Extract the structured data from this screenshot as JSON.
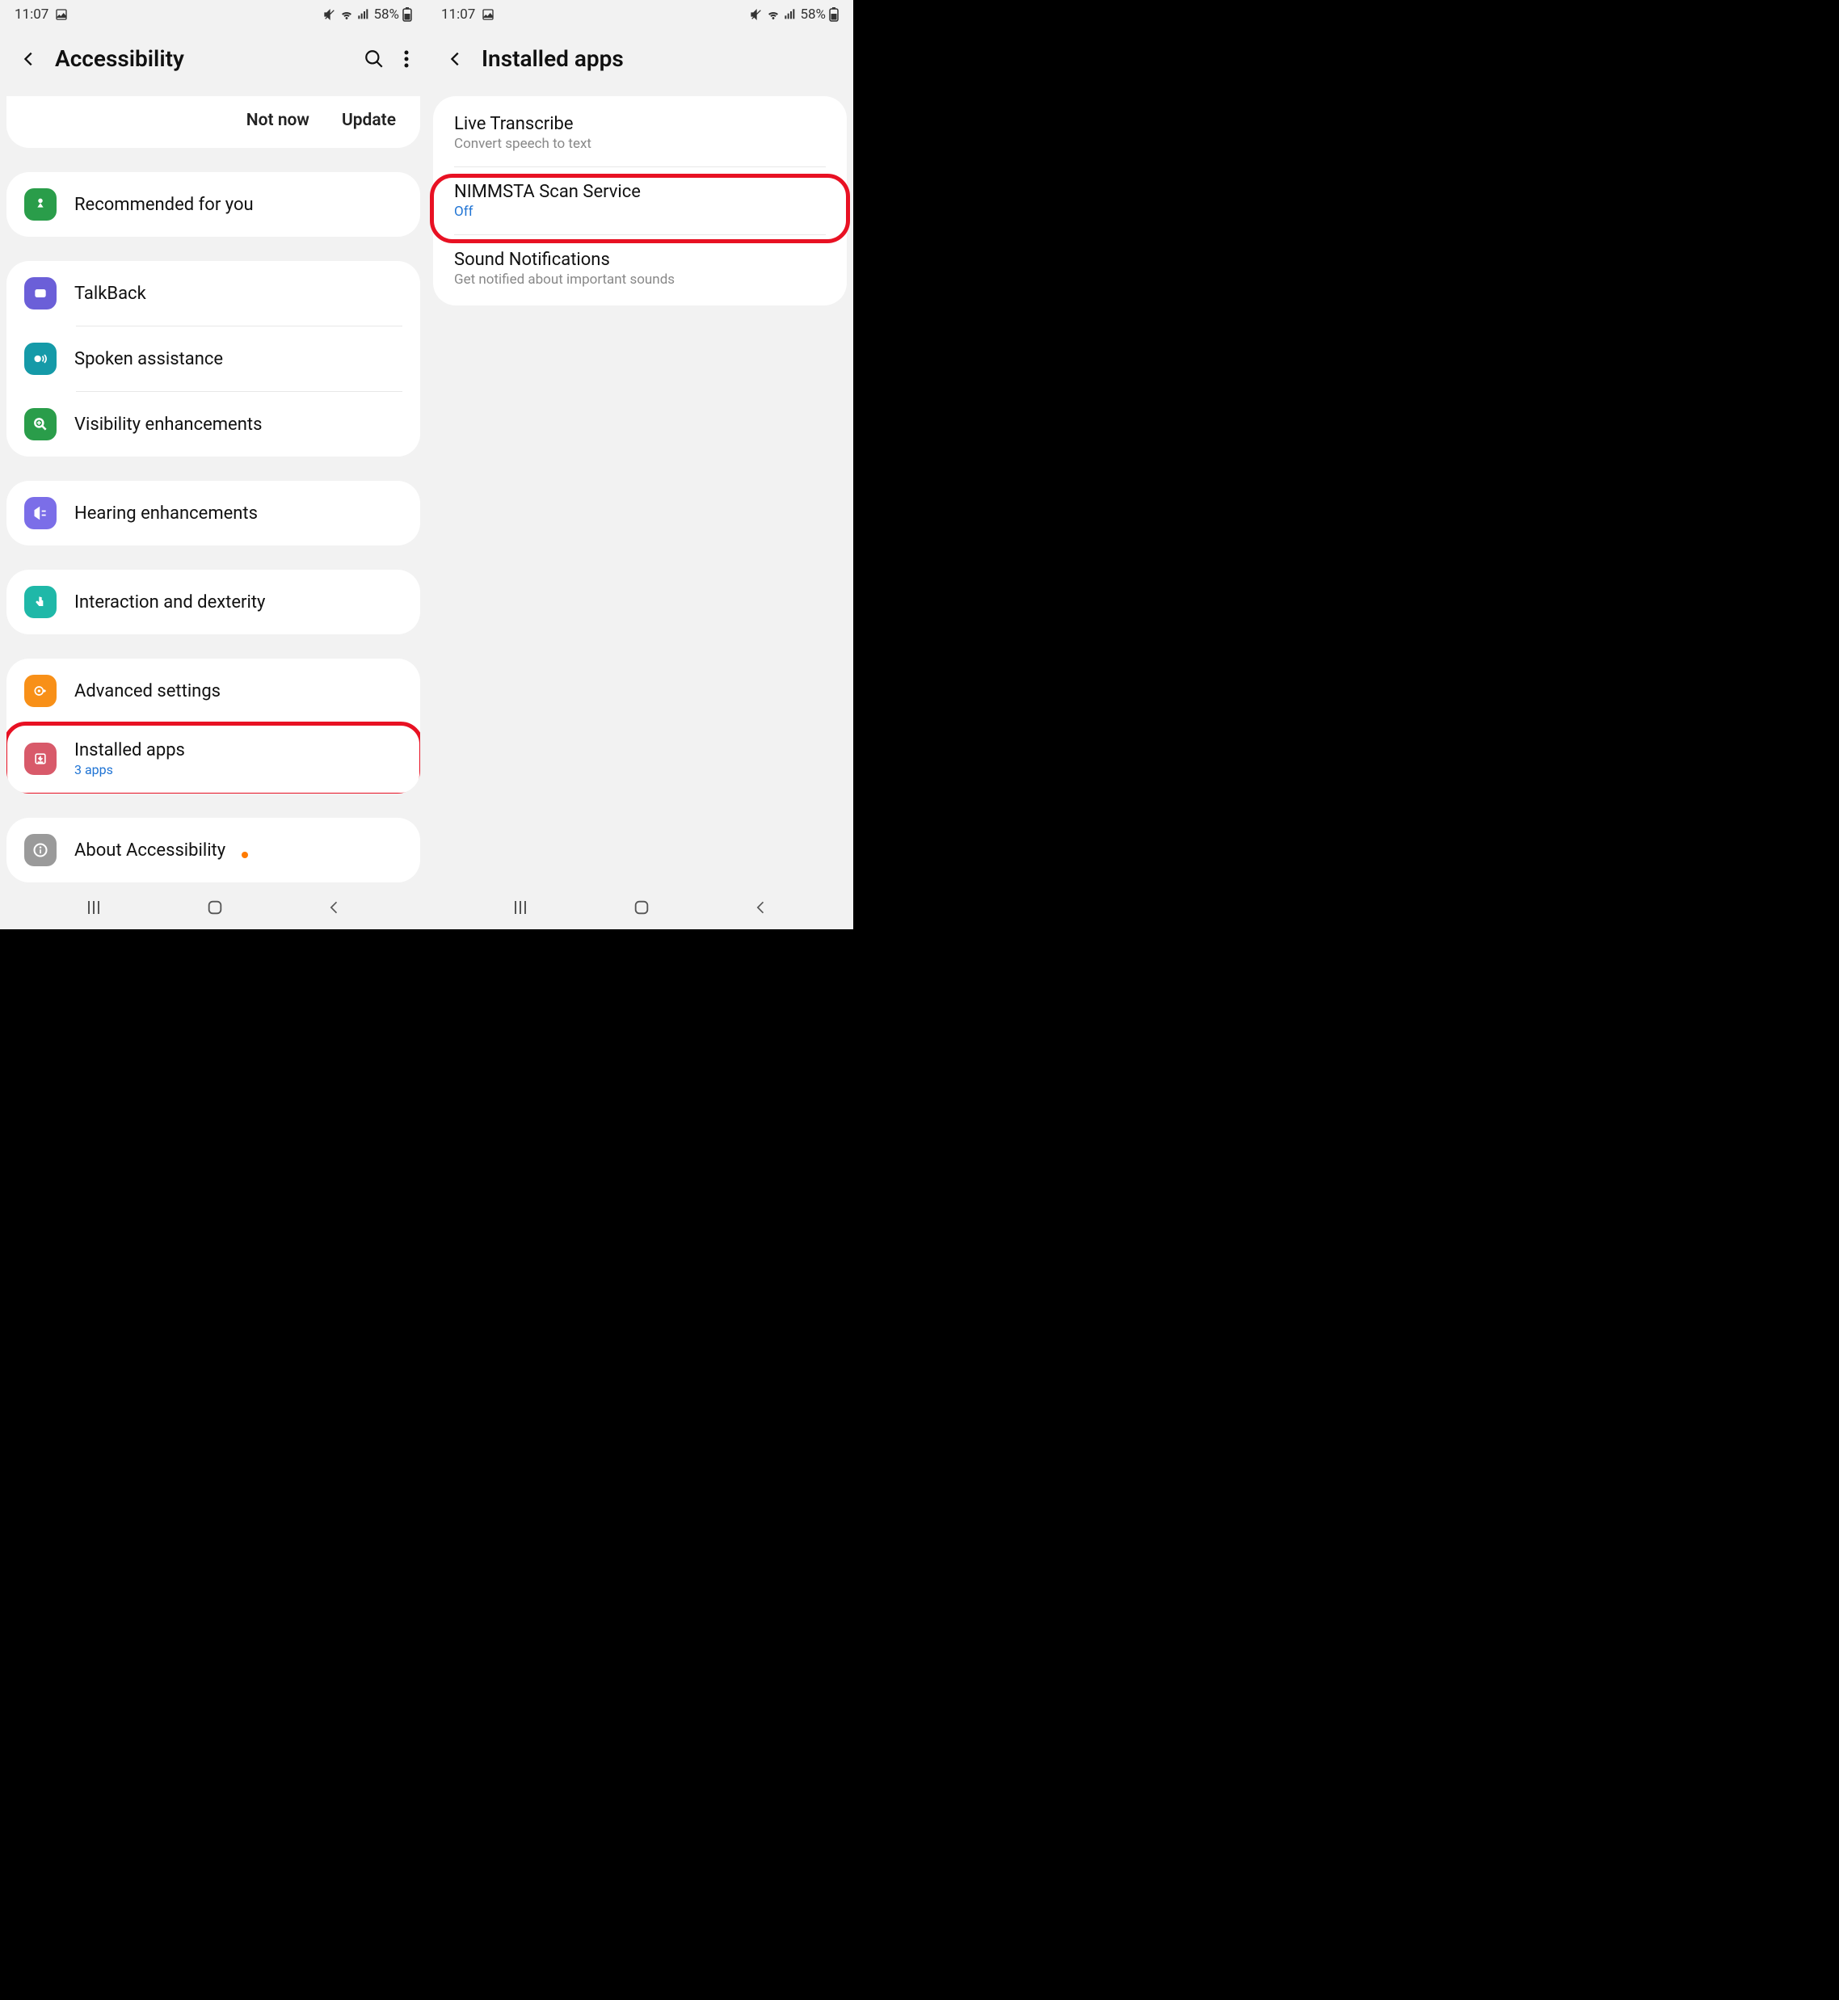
{
  "status": {
    "time": "11:07",
    "battery": "58%"
  },
  "left": {
    "title": "Accessibility",
    "update_bar": {
      "not_now": "Not now",
      "update": "Update"
    },
    "recommended": "Recommended for you",
    "talkback": "TalkBack",
    "spoken": "Spoken assistance",
    "visibility": "Visibility enhancements",
    "hearing": "Hearing enhancements",
    "interaction": "Interaction and dexterity",
    "advanced": "Advanced settings",
    "installed": {
      "title": "Installed apps",
      "sub": "3 apps"
    },
    "about": "About Accessibility"
  },
  "right": {
    "title": "Installed apps",
    "items": [
      {
        "title": "Live Transcribe",
        "sub": "Convert speech to text",
        "blue": false
      },
      {
        "title": "NIMMSTA Scan Service",
        "sub": "Off",
        "blue": true
      },
      {
        "title": "Sound Notifications",
        "sub": "Get notified about important sounds",
        "blue": false
      }
    ]
  }
}
